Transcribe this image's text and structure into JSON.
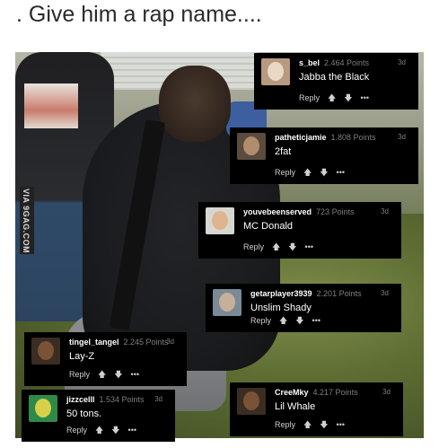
{
  "title": ". Give him a rap name....",
  "watermark": "VIA 9GAG.COM",
  "comments": [
    {
      "user": "s_bel",
      "points": "2.464 Points",
      "time": "3d",
      "text": "Jabba the Black",
      "reply": "Reply",
      "up": "🡅",
      "down": "🡇",
      "more": "•••",
      "avatar_bg": "#b89a7f",
      "face": "#ead8c6"
    },
    {
      "user": "patheticjamie",
      "points": "1.808 Points",
      "time": "3d",
      "text": "2fat",
      "reply": "Reply",
      "up": "🡅",
      "down": "🡇",
      "more": "•••",
      "avatar_bg": "#5a4b3f",
      "face": "#b08d6d"
    },
    {
      "user": "youvebeenserved",
      "points": "723 Points",
      "time": "3d",
      "text": "MC Donald",
      "reply": "Reply",
      "up": "🡅",
      "down": "🡇",
      "more": "•••",
      "avatar_bg": "#d7d7d2",
      "face": "#e0b48e"
    },
    {
      "user": "getarplayer3939",
      "points": "2.201 Points",
      "time": "3d",
      "text": "Unslim Shady",
      "reply": "Reply",
      "up": "🡅",
      "down": "🡇",
      "more": "•••",
      "avatar_bg": "#7a8a97",
      "face": "#c7b09a"
    },
    {
      "user": "tingel_tangel",
      "points": "2.245 Points",
      "time": "3d",
      "text": "Lay-Z",
      "reply": "Reply",
      "up": "🡅",
      "down": "🡇",
      "more": "•••",
      "avatar_bg": "#3b2d22",
      "face": "#7a5236"
    },
    {
      "user": "jizzcelll",
      "points": "1.534 Points",
      "time": "3d",
      "text": "50 tons.",
      "reply": "Reply",
      "up": "🡅",
      "down": "🡇",
      "more": "•••",
      "avatar_bg": "#2f8a4a",
      "face": "#d9d04a"
    },
    {
      "user": "CreeMky",
      "points": "4.217 Points",
      "time": "3d",
      "text": "Lil Whale",
      "reply": "Reply",
      "up": "🡅",
      "down": "🡇",
      "more": "•••",
      "avatar_bg": "#3b2d22",
      "face": "#7a5236"
    }
  ]
}
